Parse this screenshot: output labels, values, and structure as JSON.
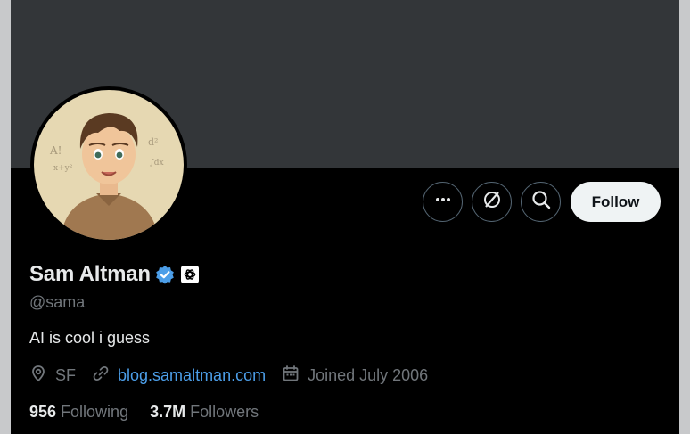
{
  "profile": {
    "display_name": "Sam Altman",
    "handle": "@sama",
    "bio": "AI is cool i guess",
    "location": "SF",
    "website": "blog.samaltman.com",
    "joined": "Joined July 2006"
  },
  "actions": {
    "follow_label": "Follow"
  },
  "stats": {
    "following_count": "956",
    "following_label": "Following",
    "followers_count": "3.7M",
    "followers_label": "Followers"
  },
  "icons": {
    "more": "more-icon",
    "grok": "grok-icon",
    "search": "search-icon",
    "verified": "verified-badge-icon",
    "affiliate": "openai-logo-icon",
    "location": "location-pin-icon",
    "link": "link-icon",
    "calendar": "calendar-icon"
  },
  "colors": {
    "background": "#000000",
    "banner": "#333639",
    "primary_text": "#e7e9ea",
    "secondary_text": "#71767b",
    "link": "#4c9ee8",
    "verified": "#4c9ee8",
    "button_border": "#536471",
    "follow_button_bg": "#eff3f4"
  }
}
